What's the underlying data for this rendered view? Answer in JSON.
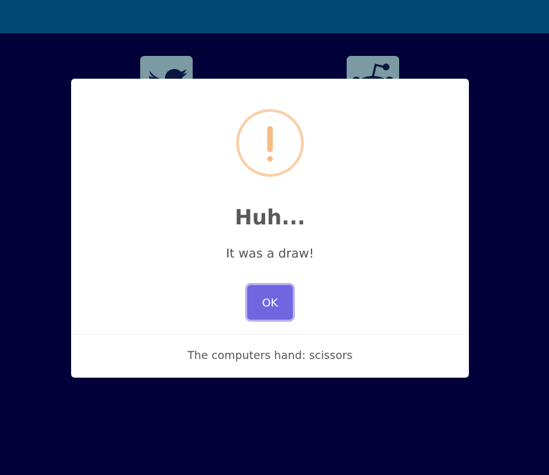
{
  "colors": {
    "topbar": "#004a73",
    "background": "#01003a",
    "share_button": "#7c9aa3",
    "warning": "#f8bb86",
    "ok_button": "#7066e0"
  },
  "share": {
    "twitter_icon": "twitter-icon",
    "reddit_icon": "reddit-icon"
  },
  "dialog": {
    "icon": "warning-icon",
    "title": "Huh...",
    "text": "It was a draw!",
    "confirm_label": "OK",
    "footer": "The computers hand: scissors"
  }
}
